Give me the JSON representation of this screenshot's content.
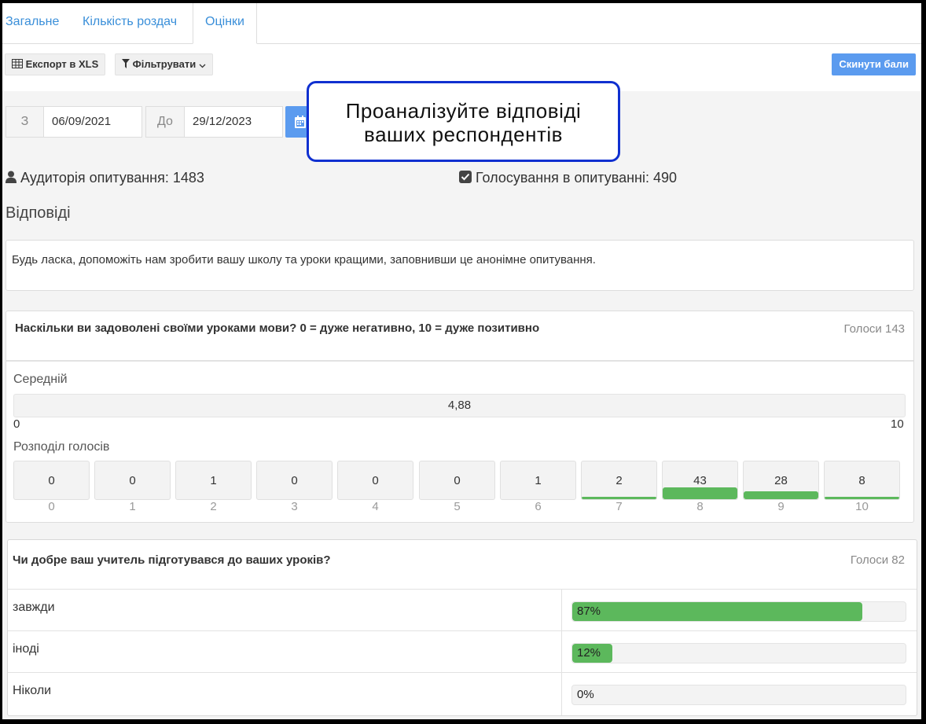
{
  "tabs": [
    {
      "label": "Загальне"
    },
    {
      "label": "Кількість роздач"
    },
    {
      "label": "Оцінки",
      "active": true
    }
  ],
  "toolbar": {
    "export_label": "Експорт в XLS",
    "filter_label": "Фільтрувати",
    "reset_label": "Скинути бали"
  },
  "date_filter": {
    "from_label": "З",
    "from_value": "06/09/2021",
    "to_label": "До",
    "to_value": "29/12/2023"
  },
  "callout": {
    "line1": "Проаналізуйте відповіді",
    "line2": "ваших респондентів"
  },
  "stats": {
    "audience": "Аудиторія опитування: 1483",
    "votes": "Голосування в опитуванні: 490"
  },
  "section_heading": "Відповіді",
  "intro_text": "Будь ласка, допоможіть нам зробити вашу школу та уроки кращими, заповнивши це анонімне опитування.",
  "question1": {
    "title": "Наскільки ви задоволені своїми уроками мови? 0 = дуже негативно, 10 = дуже позитивно",
    "votes": "Голоси 143",
    "average_label": "Середній",
    "average_value": "4,88",
    "scale_min": "0",
    "scale_max": "10",
    "distribution_label": "Розподіл голосів",
    "distribution": [
      {
        "score": "0",
        "count": "0",
        "fill": 0
      },
      {
        "score": "1",
        "count": "0",
        "fill": 0
      },
      {
        "score": "2",
        "count": "1",
        "fill": 0
      },
      {
        "score": "3",
        "count": "0",
        "fill": 0
      },
      {
        "score": "4",
        "count": "0",
        "fill": 0
      },
      {
        "score": "5",
        "count": "0",
        "fill": 0
      },
      {
        "score": "6",
        "count": "1",
        "fill": 0
      },
      {
        "score": "7",
        "count": "2",
        "fill": 0.05
      },
      {
        "score": "8",
        "count": "43",
        "fill": 0.3
      },
      {
        "score": "9",
        "count": "28",
        "fill": 0.2
      },
      {
        "score": "10",
        "count": "8",
        "fill": 0.06
      }
    ]
  },
  "question2": {
    "title": "Чи добре ваш учитель підготувався до ваших уроків?",
    "votes": "Голоси 82",
    "options": [
      {
        "label": "завжди",
        "percent_text": "87%",
        "percent": 87
      },
      {
        "label": "іноді",
        "percent_text": "12%",
        "percent": 12
      },
      {
        "label": "Ніколи",
        "percent_text": "0%",
        "percent": 0
      }
    ]
  }
}
